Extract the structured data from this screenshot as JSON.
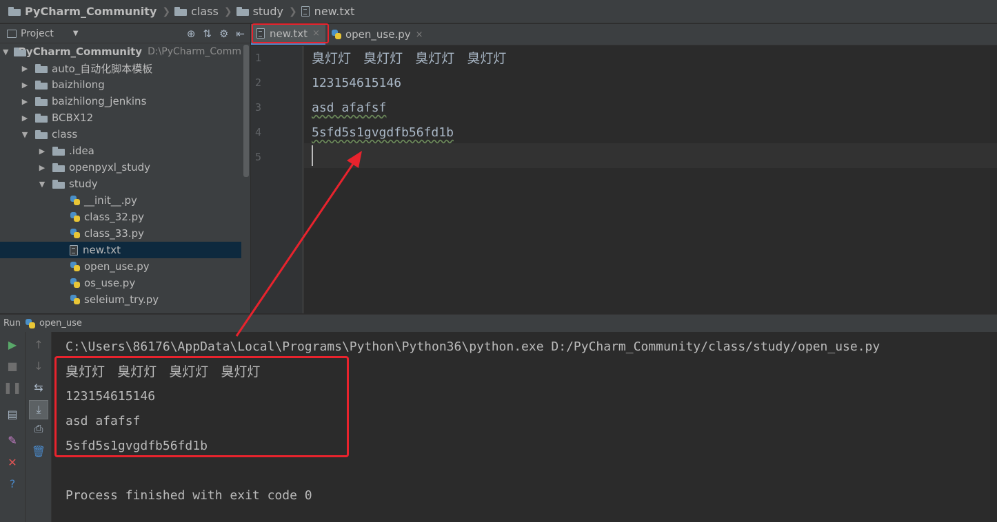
{
  "breadcrumb": [
    {
      "label": "PyCharm_Community",
      "icon": "folder-icon",
      "bold": true
    },
    {
      "label": "class",
      "icon": "folder-icon",
      "bold": false
    },
    {
      "label": "study",
      "icon": "folder-icon",
      "bold": false
    },
    {
      "label": "new.txt",
      "icon": "text-file-icon",
      "bold": false
    }
  ],
  "project_panel": {
    "title": "Project",
    "dropdown": "▼",
    "tools": [
      "⊕",
      "⇅",
      "⚙",
      "⇤"
    ],
    "tree": [
      {
        "indent": 0,
        "arrow": "▼",
        "icon": "folder",
        "label": "PyCharm_Community",
        "path": "D:\\PyCharm_Comm",
        "bold": true
      },
      {
        "indent": 1,
        "arrow": "▶",
        "icon": "folder",
        "label": "auto_自动化脚本模板"
      },
      {
        "indent": 1,
        "arrow": "▶",
        "icon": "folder",
        "label": "baizhilong"
      },
      {
        "indent": 1,
        "arrow": "▶",
        "icon": "folder",
        "label": "baizhilong_jenkins"
      },
      {
        "indent": 1,
        "arrow": "▶",
        "icon": "folder",
        "label": "BCBX12"
      },
      {
        "indent": 1,
        "arrow": "▼",
        "icon": "folder",
        "label": "class"
      },
      {
        "indent": 2,
        "arrow": "▶",
        "icon": "folder",
        "label": ".idea"
      },
      {
        "indent": 2,
        "arrow": "▶",
        "icon": "folder",
        "label": "openpyxl_study"
      },
      {
        "indent": 2,
        "arrow": "▼",
        "icon": "folder",
        "label": "study"
      },
      {
        "indent": 3,
        "arrow": "",
        "icon": "py",
        "label": "__init__.py"
      },
      {
        "indent": 3,
        "arrow": "",
        "icon": "py",
        "label": "class_32.py"
      },
      {
        "indent": 3,
        "arrow": "",
        "icon": "py",
        "label": "class_33.py"
      },
      {
        "indent": 3,
        "arrow": "",
        "icon": "txt",
        "label": "new.txt",
        "selected": true
      },
      {
        "indent": 3,
        "arrow": "",
        "icon": "py",
        "label": "open_use.py"
      },
      {
        "indent": 3,
        "arrow": "",
        "icon": "py",
        "label": "os_use.py"
      },
      {
        "indent": 3,
        "arrow": "",
        "icon": "py",
        "label": "seleium_try.py"
      }
    ]
  },
  "editor": {
    "tabs": [
      {
        "label": "new.txt",
        "close": "×",
        "active": true
      },
      {
        "label": "open_use.py",
        "close": "×",
        "active": false
      }
    ],
    "line_numbers": [
      "1",
      "2",
      "3",
      "4",
      "5"
    ],
    "lines": [
      "臭灯灯   臭灯灯   臭灯灯   臭灯灯",
      "123154615146",
      "asd afafsf",
      "5sfd5s1gvgdfb56fd1b",
      ""
    ]
  },
  "run_panel": {
    "label": "Run",
    "config": "open_use",
    "console": [
      "C:\\Users\\86176\\AppData\\Local\\Programs\\Python\\Python36\\python.exe D:/PyCharm_Community/class/study/open_use.py",
      "臭灯灯   臭灯灯   臭灯灯   臭灯灯",
      "123154615146",
      "asd afafsf",
      "5sfd5s1gvgdfb56fd1b",
      "",
      "Process finished with exit code 0"
    ]
  },
  "colors": {
    "highlight": "#e8232d",
    "background": "#2b2b2b",
    "panel": "#3c3f41"
  }
}
